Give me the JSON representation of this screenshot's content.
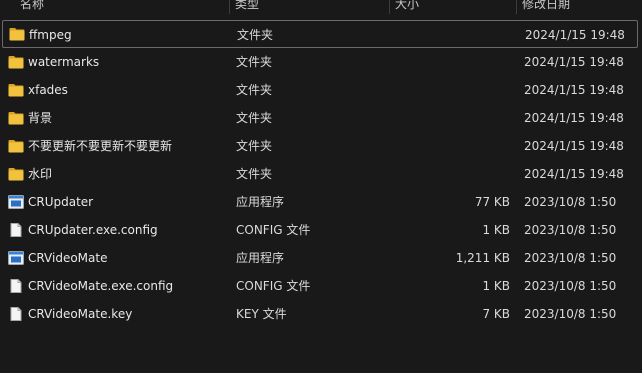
{
  "columns": {
    "name": "名称",
    "type": "类型",
    "size": "大小",
    "date": "修改日期"
  },
  "files": [
    {
      "name": "ffmpeg",
      "type": "文件夹",
      "size": "",
      "date": "2024/1/15 19:48",
      "icon": "folder-icon"
    },
    {
      "name": "watermarks",
      "type": "文件夹",
      "size": "",
      "date": "2024/1/15 19:48",
      "icon": "folder-icon"
    },
    {
      "name": "xfades",
      "type": "文件夹",
      "size": "",
      "date": "2024/1/15 19:48",
      "icon": "folder-icon"
    },
    {
      "name": "背景",
      "type": "文件夹",
      "size": "",
      "date": "2024/1/15 19:48",
      "icon": "folder-icon"
    },
    {
      "name": "不要更新不要更新不要更新",
      "type": "文件夹",
      "size": "",
      "date": "2024/1/15 19:48",
      "icon": "folder-icon"
    },
    {
      "name": "水印",
      "type": "文件夹",
      "size": "",
      "date": "2024/1/15 19:48",
      "icon": "folder-icon"
    },
    {
      "name": "CRUpdater",
      "type": "应用程序",
      "size": "77 KB",
      "date": "2023/10/8 1:50",
      "icon": "application-icon"
    },
    {
      "name": "CRUpdater.exe.config",
      "type": "CONFIG 文件",
      "size": "1 KB",
      "date": "2023/10/8 1:50",
      "icon": "file-icon"
    },
    {
      "name": "CRVideoMate",
      "type": "应用程序",
      "size": "1,211 KB",
      "date": "2023/10/8 1:50",
      "icon": "application-icon"
    },
    {
      "name": "CRVideoMate.exe.config",
      "type": "CONFIG 文件",
      "size": "1 KB",
      "date": "2023/10/8 1:50",
      "icon": "file-icon"
    },
    {
      "name": "CRVideoMate.key",
      "type": "KEY 文件",
      "size": "7 KB",
      "date": "2023/10/8 1:50",
      "icon": "file-icon"
    }
  ],
  "colors": {
    "background": "#191919",
    "folder": "#f2c23e",
    "folder_dark": "#d9a520",
    "app_blue": "#3b82d6"
  }
}
